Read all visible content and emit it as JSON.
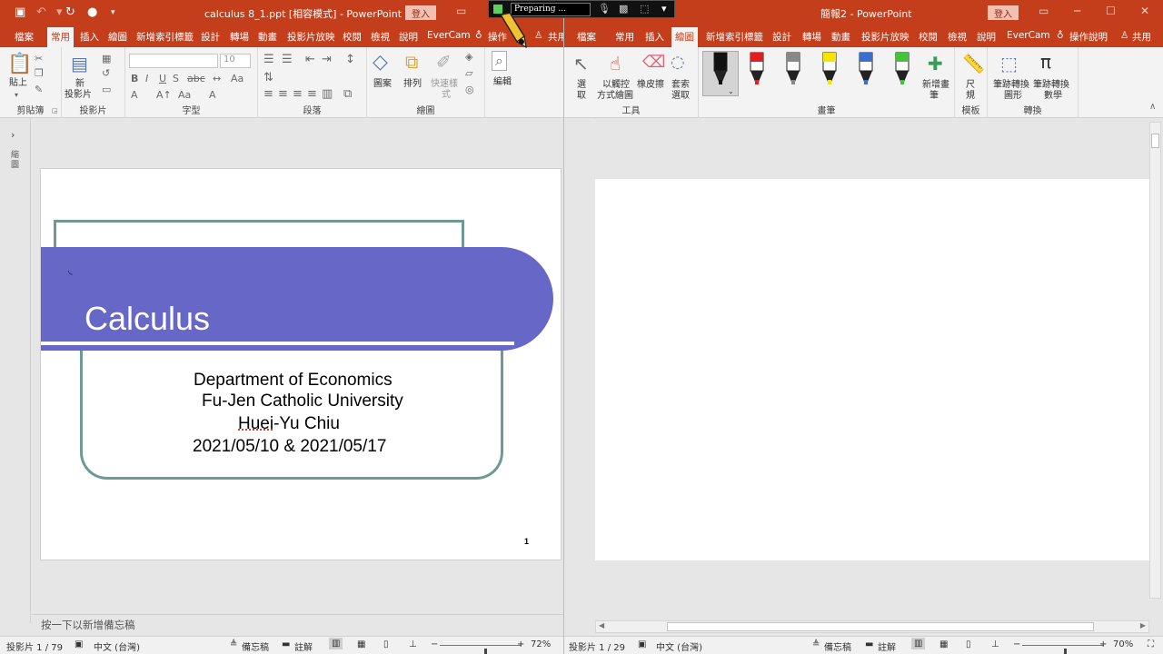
{
  "left_window": {
    "title": "calculus 8_1.ppt [相容模式]  -  PowerPoint",
    "signin": "登入",
    "tabs": [
      "檔案",
      "常用",
      "插入",
      "繪圖",
      "新增索引標籤",
      "設計",
      "轉場",
      "動畫",
      "投影片放映",
      "校閱",
      "檢視",
      "說明",
      "EverCam",
      "操作",
      "共用"
    ],
    "selected_tab": "常用",
    "ribbon": {
      "paste": "貼上",
      "new_slide_line1": "新",
      "new_slide_line2": "投影片",
      "font_size": "10",
      "shapes": "圖案",
      "arrange": "排列",
      "quick_styles_line1": "快速樣",
      "quick_styles_line2": "式",
      "editing": "編輯",
      "groups": [
        "剪貼簿",
        "投影片",
        "字型",
        "段落",
        "繪圖"
      ]
    },
    "thumb_label": "縮圖",
    "slide": {
      "title": "Calculus",
      "line1": "Department of Economics",
      "line2": "Fu-Jen Catholic University",
      "line3a": "Huei",
      "line3b": "-Yu Chiu",
      "line4": "2021/05/10 & 2021/05/17",
      "page_number": "1"
    },
    "notes_placeholder": "按一下以新增備忘稿",
    "status": {
      "slide": "投影片 1 / 79",
      "lang": "中文 (台灣)",
      "notes": "備忘稿",
      "comments": "註解",
      "zoom": "72%",
      "zoom_fraction": 0.55
    }
  },
  "right_window": {
    "title": "簡報2  -  PowerPoint",
    "signin": "登入",
    "tabs": [
      "檔案",
      "常用",
      "插入",
      "繪圖",
      "新增索引標籤",
      "設計",
      "轉場",
      "動畫",
      "投影片放映",
      "校閱",
      "檢視",
      "說明",
      "EverCam",
      "操作說明",
      "共用"
    ],
    "selected_tab": "繪圖",
    "ribbon": {
      "select_line1": "選",
      "select_line2": "取",
      "touch_draw_line1": "以觸控",
      "touch_draw_line2": "方式繪圖",
      "eraser": "橡皮擦",
      "lasso_line1": "套索",
      "lasso_line2": "選取",
      "add_pen_line1": "新增畫",
      "add_pen_line2": "筆",
      "ruler_line1": "尺",
      "ruler_line2": "規",
      "ink_to_shape_line1": "筆跡轉換",
      "ink_to_shape_line2": "圖形",
      "ink_to_math_line1": "筆跡轉換",
      "ink_to_math_line2": "數學",
      "groups": [
        "工具",
        "畫筆",
        "模板",
        "轉換"
      ],
      "pen_colors": [
        "#111111",
        "#e02020",
        "#888888",
        "#f4e600",
        "#3a6fd0",
        "#44c23a"
      ]
    },
    "thumb_label": "縮圖",
    "status": {
      "slide": "投影片 1 / 29",
      "lang": "中文 (台灣)",
      "notes": "備忘稿",
      "comments": "註解",
      "zoom": "70%",
      "zoom_fraction": 0.52
    }
  },
  "recorder": {
    "status": "Preparing ..."
  },
  "colors": {
    "accent": "#c43e1c",
    "slide_band": "#6767c8",
    "slide_frame": "#6f9a93"
  }
}
